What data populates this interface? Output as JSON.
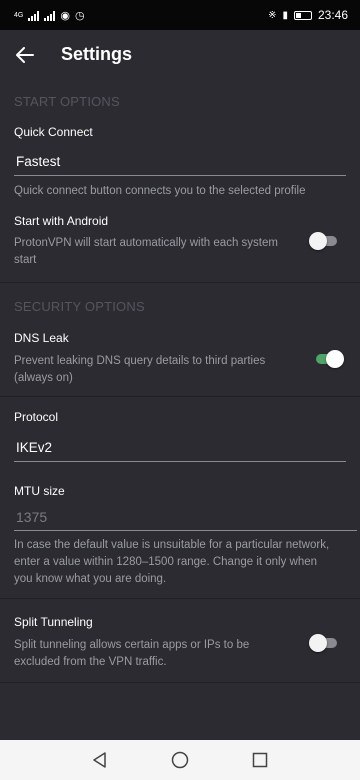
{
  "status_bar": {
    "network_label": "4G",
    "time": "23:46"
  },
  "app_bar": {
    "back_icon": "arrow-left-icon",
    "title": "Settings"
  },
  "start_options": {
    "header": "START OPTIONS",
    "quick_connect": {
      "label": "Quick Connect",
      "value": "Fastest",
      "description": "Quick connect button connects you to the selected profile"
    },
    "start_with_android": {
      "label": "Start with Android",
      "description_line1": "ProtonVPN will start automatically with each system",
      "description_line2": "start",
      "enabled": false
    }
  },
  "security_options": {
    "header": "SECURITY OPTIONS",
    "dns_leak": {
      "label": "DNS Leak",
      "description_line1": "Prevent leaking DNS query details to third parties",
      "description_line2": "(always on)",
      "enabled": true
    },
    "protocol": {
      "label": "Protocol",
      "value": "IKEv2"
    },
    "mtu": {
      "label": "MTU size",
      "placeholder": "1375",
      "description_line1": "In case the default value is unsuitable for a particular network,",
      "description_line2": "enter a value within 1280–1500 range. Change it only when",
      "description_line3": "you know what you are doing."
    },
    "split_tunneling": {
      "label": "Split Tunneling",
      "description_line1": "Split tunneling allows certain apps or IPs to be",
      "description_line2": "excluded from the VPN traffic.",
      "enabled": false
    }
  },
  "colors": {
    "background": "#2b2b31",
    "accent_toggle_on": "#4fa568",
    "section_header": "#55555d",
    "description": "#9b9ba3"
  },
  "nav_bar": {
    "back_icon": "triangle-back-icon",
    "home_icon": "circle-home-icon",
    "recents_icon": "square-recents-icon"
  }
}
